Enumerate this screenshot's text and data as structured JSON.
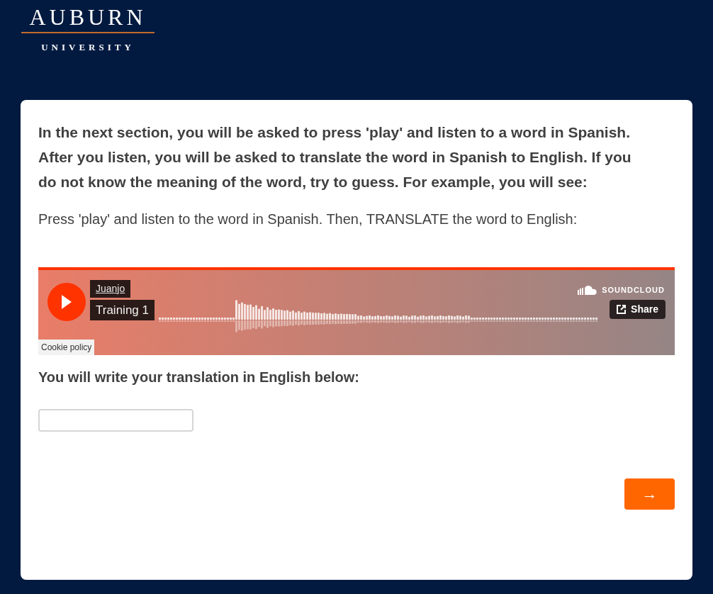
{
  "logo": {
    "name": "AUBURN",
    "subtitle": "UNIVERSITY"
  },
  "intro": "In the next section, you will be asked to press 'play' and listen to a word in Spanish. After you listen, you will be asked to translate the word in Spanish to English. If you do not know the meaning of the word, try to guess. For example, you will see:",
  "prompt": "Press 'play' and listen to the word in Spanish. Then, TRANSLATE the word to English:",
  "player": {
    "artist": "Juanjo",
    "track": "Training 1",
    "brand": "SOUNDCLOUD",
    "share": "Share",
    "cookie": "Cookie policy"
  },
  "answer_label": "You will write your translation in English below:",
  "next_button": "→"
}
